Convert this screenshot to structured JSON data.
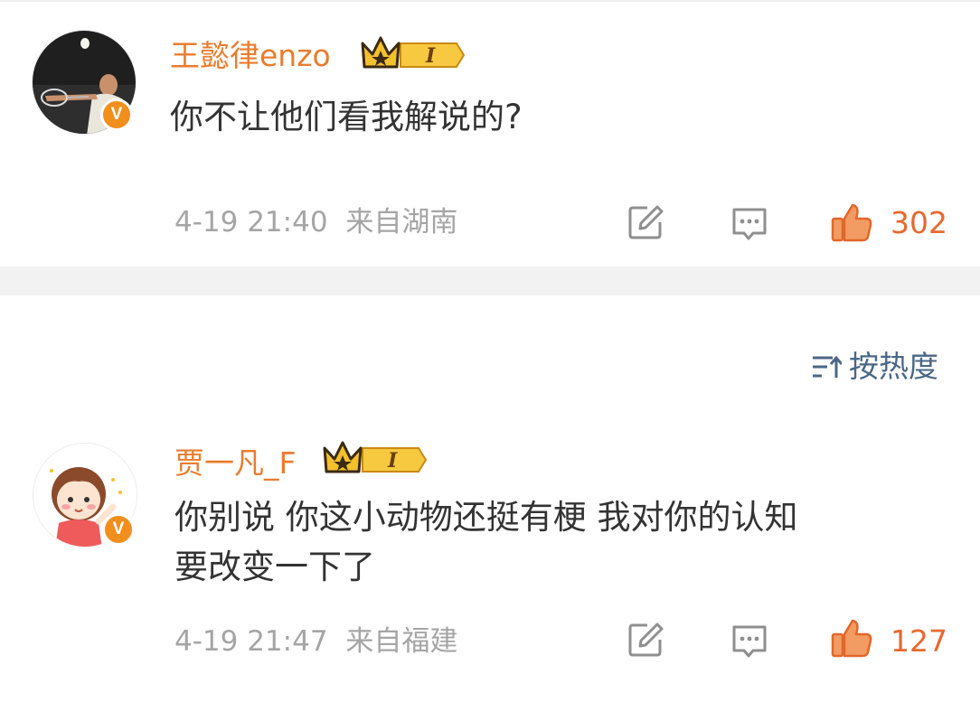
{
  "comments": [
    {
      "username": "王懿律enzo",
      "badge_level": "I",
      "text_lines": [
        "你不让他们看我解说的?"
      ],
      "time": "4-19 21:40",
      "location": "来自湖南",
      "likes": "302",
      "avatar_icon": "badminton-player-photo"
    },
    {
      "username": "贾一凡_F",
      "badge_level": "I",
      "text_lines": [
        "你别说 你这小动物还挺有梗 我对你的认知",
        "要改变一下了"
      ],
      "time": "4-19 21:47",
      "location": "来自福建",
      "likes": "127",
      "avatar_icon": "cartoon-girl-avatar"
    }
  ],
  "sort": {
    "label": "按热度",
    "icon": "sort-icon"
  },
  "verified_mark": "V",
  "colors": {
    "username": "#eb7c2d",
    "like": "#e8692f",
    "meta": "#a5a5a5",
    "sort": "#4a6785",
    "badge": "#f28f1c"
  }
}
